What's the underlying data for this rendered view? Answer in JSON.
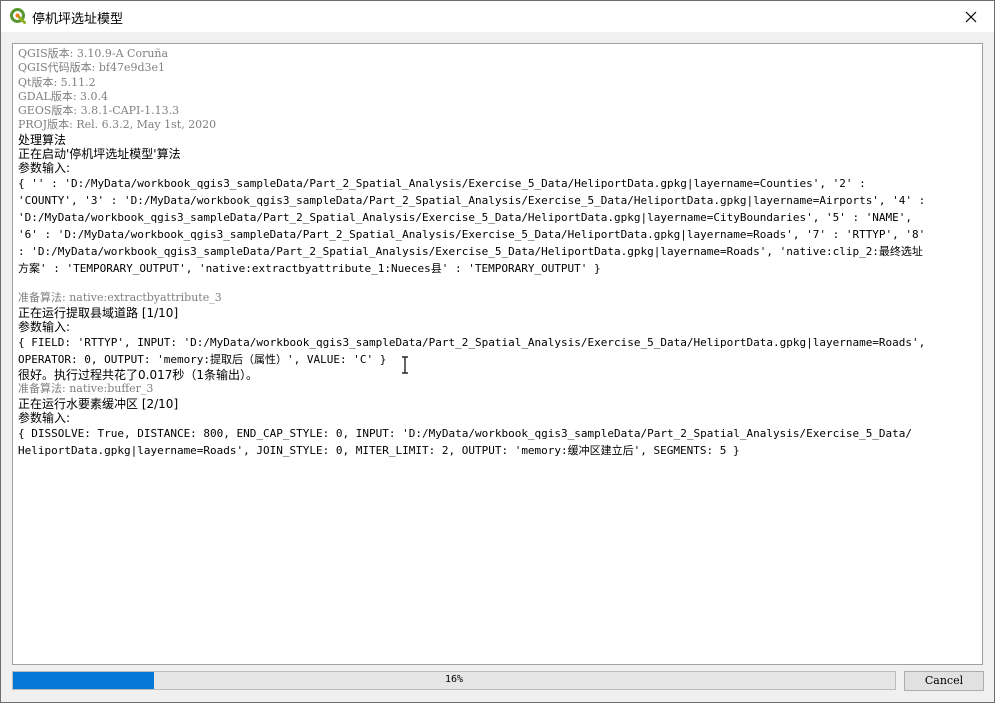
{
  "window": {
    "title": "停机坪选址模型",
    "app_icon": "qgis-icon",
    "close_icon": "close-icon"
  },
  "log": {
    "version_lines": [
      "QGIS版本: 3.10.9-A Coruña",
      "QGIS代码版本: bf47e9d3e1",
      "Qt版本: 5.11.2",
      "GDAL版本: 3.0.4",
      "GEOS版本: 3.8.1-CAPI-1.13.3",
      "PROJ版本: Rel. 6.3.2, May 1st, 2020"
    ],
    "processing_label": "处理算法",
    "starting_line": "正在启动'停机坪选址模型'算法",
    "params_label_1": "参数输入:",
    "params_1": [
      "{ '' : 'D:/MyData/workbook_qgis3_sampleData/Part_2_Spatial_Analysis/Exercise_5_Data/HeliportData.gpkg|layername=Counties', '2' :",
      "'COUNTY', '3' : 'D:/MyData/workbook_qgis3_sampleData/Part_2_Spatial_Analysis/Exercise_5_Data/HeliportData.gpkg|layername=Airports', '4' :",
      "'D:/MyData/workbook_qgis3_sampleData/Part_2_Spatial_Analysis/Exercise_5_Data/HeliportData.gpkg|layername=CityBoundaries', '5' : 'NAME',",
      "'6' : 'D:/MyData/workbook_qgis3_sampleData/Part_2_Spatial_Analysis/Exercise_5_Data/HeliportData.gpkg|layername=Roads', '7' : 'RTTYP', '8'",
      ": 'D:/MyData/workbook_qgis3_sampleData/Part_2_Spatial_Analysis/Exercise_5_Data/HeliportData.gpkg|layername=Roads', 'native:clip_2:最终选址",
      "方案' : 'TEMPORARY_OUTPUT', 'native:extractbyattribute_1:Nueces县' : 'TEMPORARY_OUTPUT' }"
    ],
    "prepare_1": "准备算法: native:extractbyattribute_3",
    "running_1": "正在运行提取县域道路 [1/10]",
    "params_label_2": "参数输入:",
    "params_2": [
      "{ FIELD: 'RTTYP', INPUT: 'D:/MyData/workbook_qgis3_sampleData/Part_2_Spatial_Analysis/Exercise_5_Data/HeliportData.gpkg|layername=Roads',",
      "OPERATOR: 0, OUTPUT: 'memory:提取后（属性）', VALUE: 'C' }"
    ],
    "done_1": "很好。执行过程共花了0.017秒（1条输出）。",
    "prepare_2": "准备算法: native:buffer_3",
    "running_2": "正在运行水要素缓冲区 [2/10]",
    "params_label_3": "参数输入:",
    "params_3": [
      "{ DISSOLVE: True, DISTANCE: 800, END_CAP_STYLE: 0, INPUT: 'D:/MyData/workbook_qgis3_sampleData/Part_2_Spatial_Analysis/Exercise_5_Data/",
      "HeliportData.gpkg|layername=Roads', JOIN_STYLE: 0, MITER_LIMIT: 2, OUTPUT: 'memory:缓冲区建立后', SEGMENTS: 5 }"
    ]
  },
  "progress": {
    "value": 0.16,
    "label": "16%",
    "fill_color": "#0679d6"
  },
  "cancel_label": "Cancel"
}
